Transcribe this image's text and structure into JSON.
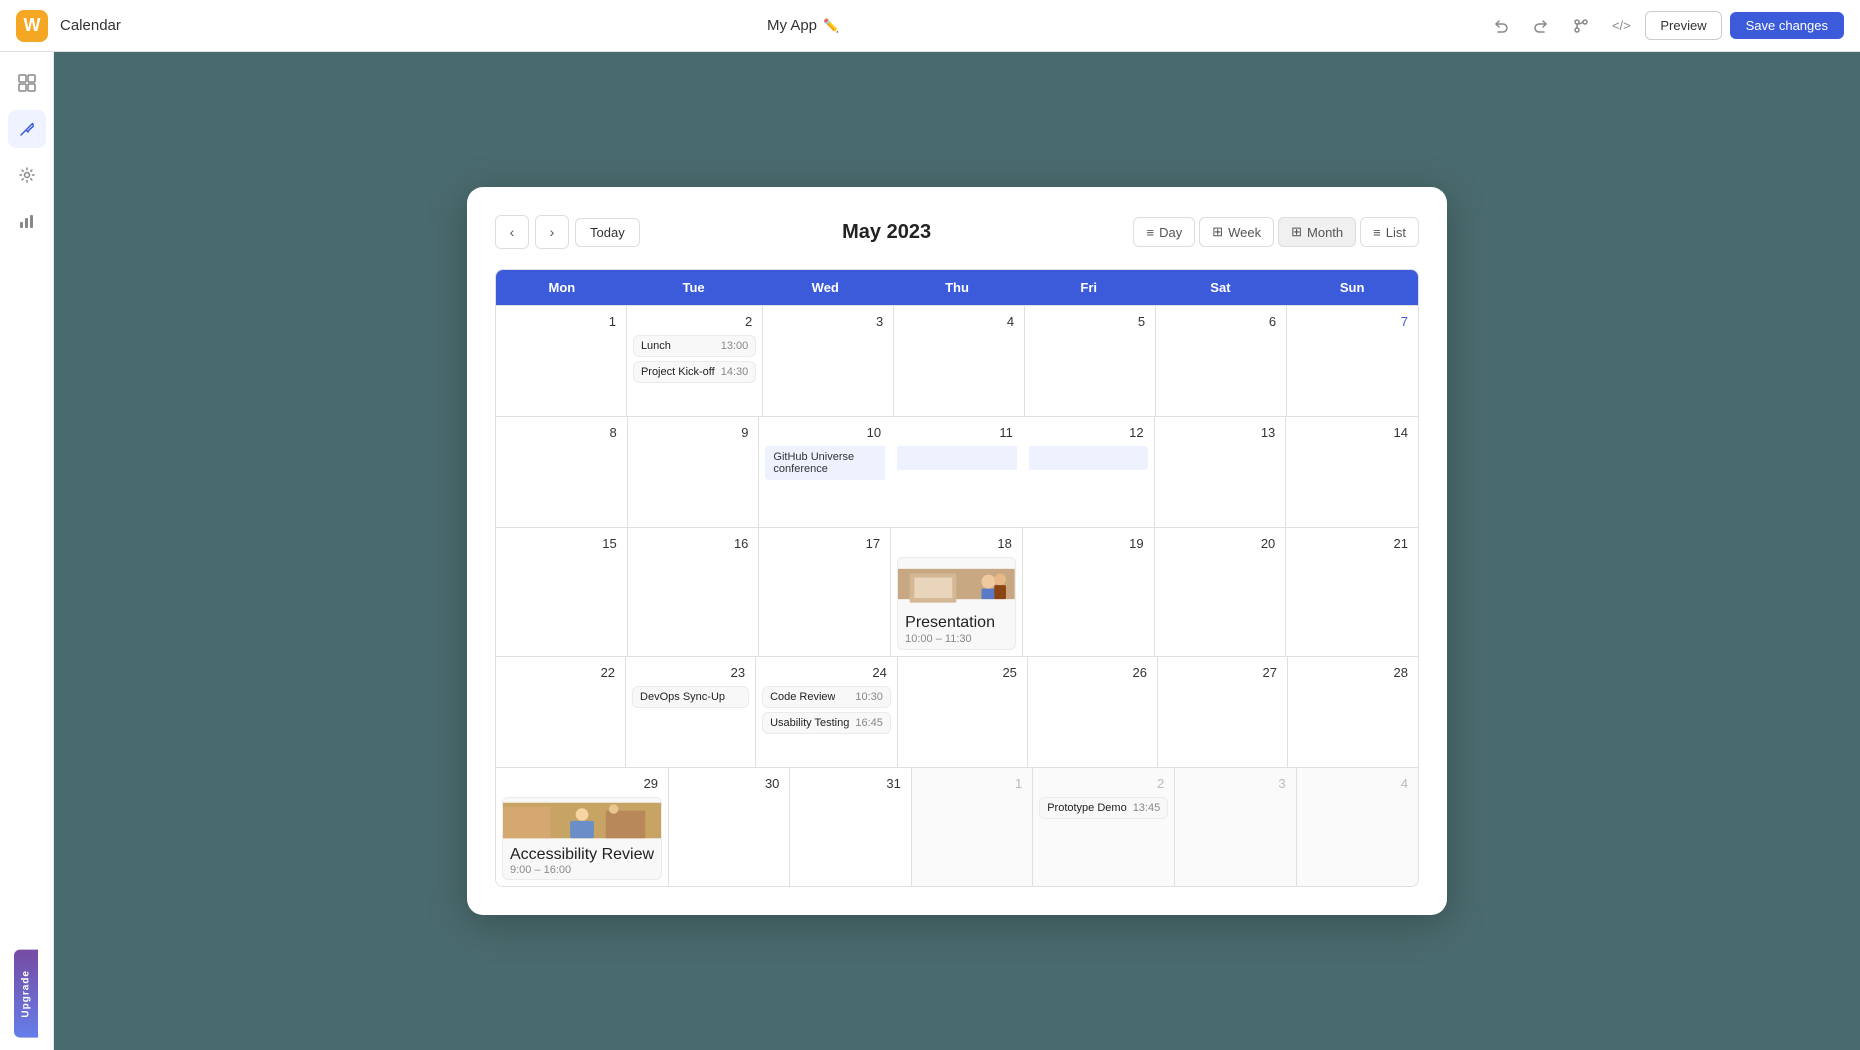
{
  "topbar": {
    "logo_text": "W",
    "title": "Calendar",
    "app_name": "My App",
    "edit_icon": "✏",
    "undo_label": "undo",
    "redo_label": "redo",
    "branch_label": "branch",
    "code_label": "code",
    "preview_label": "Preview",
    "save_label": "Save changes"
  },
  "sidebar": {
    "items": [
      {
        "icon": "⊞",
        "name": "dashboard",
        "active": false
      },
      {
        "icon": "⚒",
        "name": "tools",
        "active": true
      },
      {
        "icon": "⚙",
        "name": "settings",
        "active": false
      },
      {
        "icon": "📊",
        "name": "analytics",
        "active": false
      }
    ]
  },
  "calendar": {
    "title": "May 2023",
    "nav": {
      "prev": "‹",
      "next": "›",
      "today": "Today"
    },
    "views": [
      {
        "label": "Day",
        "active": false
      },
      {
        "label": "Week",
        "active": false
      },
      {
        "label": "Month",
        "active": true
      },
      {
        "label": "List",
        "active": false
      }
    ],
    "day_headers": [
      "Mon",
      "Tue",
      "Wed",
      "Thu",
      "Fri",
      "Sat",
      "Sun"
    ],
    "weeks": [
      {
        "days": [
          {
            "date": "1",
            "other": false,
            "sunday": false,
            "events": []
          },
          {
            "date": "2",
            "other": false,
            "sunday": false,
            "events": [
              {
                "name": "Lunch",
                "time": "13:00"
              },
              {
                "name": "Project Kick-off",
                "time": "14:30"
              }
            ]
          },
          {
            "date": "3",
            "other": false,
            "sunday": false,
            "events": []
          },
          {
            "date": "4",
            "other": false,
            "sunday": false,
            "events": []
          },
          {
            "date": "5",
            "other": false,
            "sunday": false,
            "events": []
          },
          {
            "date": "6",
            "other": false,
            "sunday": false,
            "events": []
          },
          {
            "date": "7",
            "other": false,
            "sunday": true,
            "events": []
          }
        ]
      },
      {
        "days": [
          {
            "date": "8",
            "other": false,
            "sunday": false,
            "events": []
          },
          {
            "date": "9",
            "other": false,
            "sunday": false,
            "events": []
          },
          {
            "date": "10",
            "other": false,
            "sunday": false,
            "multi_day": "GitHub Universe conference",
            "events": []
          },
          {
            "date": "11",
            "other": false,
            "sunday": false,
            "events": []
          },
          {
            "date": "12",
            "other": false,
            "sunday": false,
            "events": []
          },
          {
            "date": "13",
            "other": false,
            "sunday": false,
            "events": []
          },
          {
            "date": "14",
            "other": false,
            "sunday": false,
            "events": []
          }
        ]
      },
      {
        "days": [
          {
            "date": "15",
            "other": false,
            "sunday": false,
            "events": []
          },
          {
            "date": "16",
            "other": false,
            "sunday": false,
            "events": []
          },
          {
            "date": "17",
            "other": false,
            "sunday": false,
            "events": []
          },
          {
            "date": "18",
            "other": false,
            "sunday": false,
            "events": [],
            "presentation": true
          },
          {
            "date": "19",
            "other": false,
            "sunday": false,
            "events": []
          },
          {
            "date": "20",
            "other": false,
            "sunday": false,
            "events": []
          },
          {
            "date": "21",
            "other": false,
            "sunday": false,
            "events": []
          }
        ]
      },
      {
        "days": [
          {
            "date": "22",
            "other": false,
            "sunday": false,
            "events": []
          },
          {
            "date": "23",
            "other": false,
            "sunday": false,
            "events": [
              {
                "name": "DevOps Sync-Up",
                "time": ""
              }
            ]
          },
          {
            "date": "24",
            "other": false,
            "sunday": false,
            "events": [
              {
                "name": "Code Review",
                "time": "10:30"
              },
              {
                "name": "Usability Testing",
                "time": "16:45"
              }
            ]
          },
          {
            "date": "25",
            "other": false,
            "sunday": false,
            "events": []
          },
          {
            "date": "26",
            "other": false,
            "sunday": false,
            "events": []
          },
          {
            "date": "27",
            "other": false,
            "sunday": false,
            "events": []
          },
          {
            "date": "28",
            "other": false,
            "sunday": false,
            "events": []
          }
        ]
      },
      {
        "days": [
          {
            "date": "29",
            "other": false,
            "sunday": false,
            "events": [],
            "accessibility": true
          },
          {
            "date": "30",
            "other": false,
            "sunday": false,
            "events": []
          },
          {
            "date": "31",
            "other": false,
            "sunday": false,
            "events": []
          },
          {
            "date": "1",
            "other": true,
            "sunday": false,
            "events": []
          },
          {
            "date": "2",
            "other": true,
            "sunday": false,
            "events": [
              {
                "name": "Prototype Demo",
                "time": "13:45"
              }
            ]
          },
          {
            "date": "3",
            "other": true,
            "sunday": false,
            "events": []
          },
          {
            "date": "4",
            "other": true,
            "sunday": false,
            "events": []
          }
        ]
      }
    ],
    "presentation_event": {
      "name": "Presentation",
      "time": "10:00 – 11:30"
    },
    "accessibility_event": {
      "name": "Accessibility Review",
      "time": "9:00 – 16:00"
    },
    "github_event": "GitHub Universe conference"
  },
  "upgrade": "Upgrade",
  "colors": {
    "header_bg": "#3b5bdb",
    "accent": "#3b5bdb"
  }
}
